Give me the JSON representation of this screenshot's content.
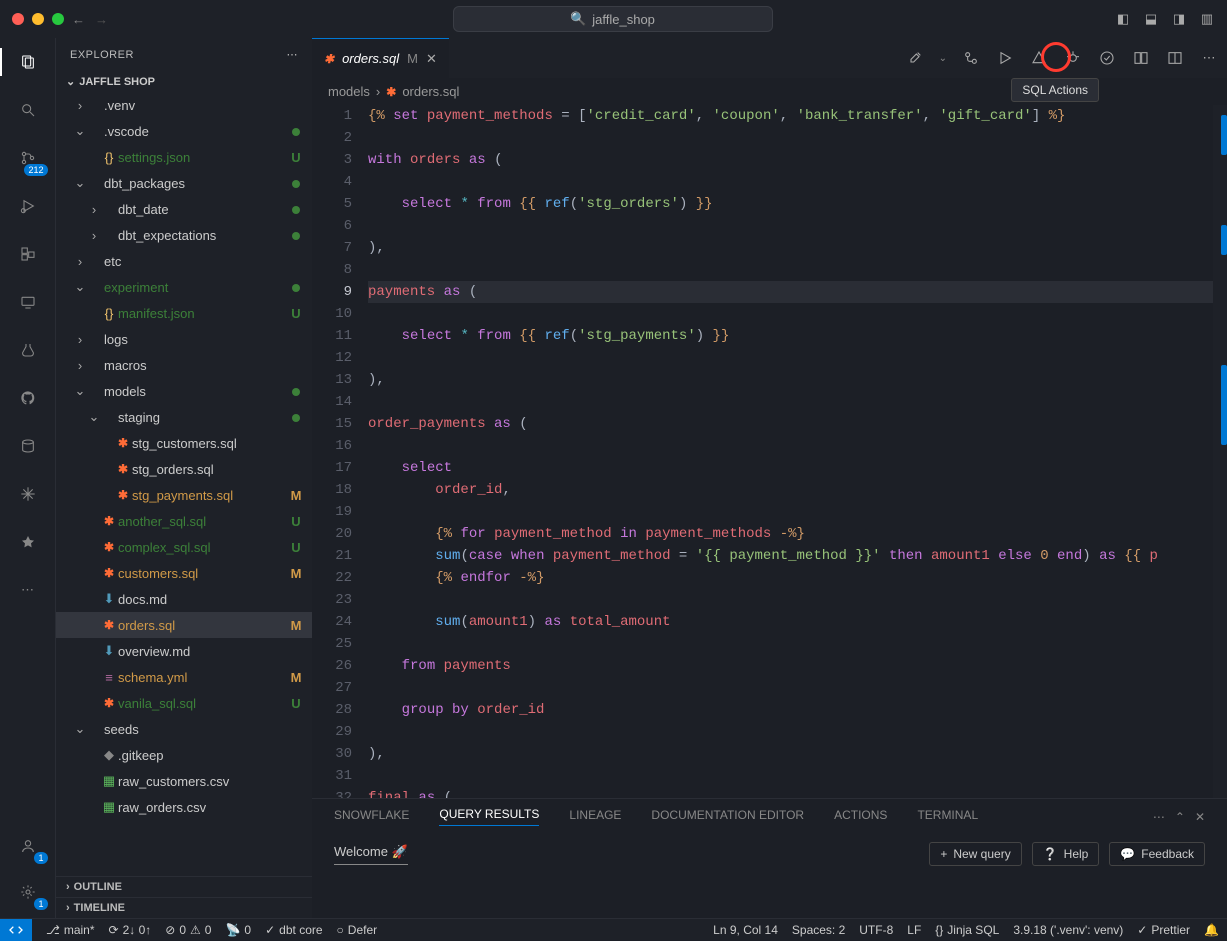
{
  "title_search": "jaffle_shop",
  "explorer": {
    "title": "EXPLORER",
    "root": "JAFFLE SHOP"
  },
  "tree": [
    {
      "indent": 1,
      "tw": "›",
      "icon": "",
      "label": ".venv",
      "status": "",
      "cls": ""
    },
    {
      "indent": 1,
      "tw": "⌄",
      "icon": "",
      "label": ".vscode",
      "status": "dot",
      "cls": ""
    },
    {
      "indent": 2,
      "tw": "",
      "icon": "{}",
      "iconcls": "json-ic",
      "label": "settings.json",
      "status": "U",
      "cls": "git-u"
    },
    {
      "indent": 1,
      "tw": "⌄",
      "icon": "",
      "label": "dbt_packages",
      "status": "dot",
      "cls": ""
    },
    {
      "indent": 2,
      "tw": "›",
      "icon": "",
      "label": "dbt_date",
      "status": "dot",
      "cls": ""
    },
    {
      "indent": 2,
      "tw": "›",
      "icon": "",
      "label": "dbt_expectations",
      "status": "dot",
      "cls": ""
    },
    {
      "indent": 1,
      "tw": "›",
      "icon": "",
      "label": "etc",
      "status": "",
      "cls": ""
    },
    {
      "indent": 1,
      "tw": "⌄",
      "icon": "",
      "label": "experiment",
      "status": "dot",
      "cls": "git-u"
    },
    {
      "indent": 2,
      "tw": "",
      "icon": "{}",
      "iconcls": "json-ic",
      "label": "manifest.json",
      "status": "U",
      "cls": "git-u"
    },
    {
      "indent": 1,
      "tw": "›",
      "icon": "",
      "label": "logs",
      "status": "",
      "cls": ""
    },
    {
      "indent": 1,
      "tw": "›",
      "icon": "",
      "label": "macros",
      "status": "",
      "cls": ""
    },
    {
      "indent": 1,
      "tw": "⌄",
      "icon": "",
      "label": "models",
      "status": "dot",
      "cls": ""
    },
    {
      "indent": 2,
      "tw": "⌄",
      "icon": "",
      "label": "staging",
      "status": "dot",
      "cls": ""
    },
    {
      "indent": 3,
      "tw": "",
      "icon": "✱",
      "iconcls": "dbt-ic",
      "label": "stg_customers.sql",
      "status": "",
      "cls": ""
    },
    {
      "indent": 3,
      "tw": "",
      "icon": "✱",
      "iconcls": "dbt-ic",
      "label": "stg_orders.sql",
      "status": "",
      "cls": ""
    },
    {
      "indent": 3,
      "tw": "",
      "icon": "✱",
      "iconcls": "dbt-ic",
      "label": "stg_payments.sql",
      "status": "M",
      "cls": "git-m"
    },
    {
      "indent": 2,
      "tw": "",
      "icon": "✱",
      "iconcls": "dbt-ic",
      "label": "another_sql.sql",
      "status": "U",
      "cls": "git-u"
    },
    {
      "indent": 2,
      "tw": "",
      "icon": "✱",
      "iconcls": "dbt-ic",
      "label": "complex_sql.sql",
      "status": "U",
      "cls": "git-u"
    },
    {
      "indent": 2,
      "tw": "",
      "icon": "✱",
      "iconcls": "dbt-ic",
      "label": "customers.sql",
      "status": "M",
      "cls": "git-m"
    },
    {
      "indent": 2,
      "tw": "",
      "icon": "⬇",
      "iconcls": "md-ic",
      "label": "docs.md",
      "status": "",
      "cls": ""
    },
    {
      "indent": 2,
      "tw": "",
      "icon": "✱",
      "iconcls": "dbt-ic",
      "label": "orders.sql",
      "status": "M",
      "cls": "git-m",
      "sel": true
    },
    {
      "indent": 2,
      "tw": "",
      "icon": "⬇",
      "iconcls": "md-ic",
      "label": "overview.md",
      "status": "",
      "cls": ""
    },
    {
      "indent": 2,
      "tw": "",
      "icon": "≡",
      "iconcls": "yml-ic",
      "label": "schema.yml",
      "status": "M",
      "cls": "git-m"
    },
    {
      "indent": 2,
      "tw": "",
      "icon": "✱",
      "iconcls": "dbt-ic",
      "label": "vanila_sql.sql",
      "status": "U",
      "cls": "git-u"
    },
    {
      "indent": 1,
      "tw": "⌄",
      "icon": "",
      "label": "seeds",
      "status": "",
      "cls": ""
    },
    {
      "indent": 2,
      "tw": "",
      "icon": "◆",
      "iconcls": "gen-ic",
      "label": ".gitkeep",
      "status": "",
      "cls": ""
    },
    {
      "indent": 2,
      "tw": "",
      "icon": "▦",
      "iconcls": "csv-ic",
      "label": "raw_customers.csv",
      "status": "",
      "cls": ""
    },
    {
      "indent": 2,
      "tw": "",
      "icon": "▦",
      "iconcls": "csv-ic",
      "label": "raw_orders.csv",
      "status": "",
      "cls": ""
    }
  ],
  "outline": "OUTLINE",
  "timeline": "TIMELINE",
  "tab": {
    "label": "orders.sql",
    "suffix": "M"
  },
  "tooltip": "SQL Actions",
  "breadcrumb": {
    "seg1": "models",
    "seg2": "orders.sql"
  },
  "activity_badge_git": "212",
  "code_lines": [
    "<span class='c-tpl'>{%</span> <span class='c-kw'>set</span> <span class='c-id'>payment_methods</span> <span class='c-pn'>=</span> <span class='c-pn'>[</span><span class='c-str'>'credit_card'</span><span class='c-pn'>,</span> <span class='c-str'>'coupon'</span><span class='c-pn'>,</span> <span class='c-str'>'bank_transfer'</span><span class='c-pn'>,</span> <span class='c-str'>'gift_card'</span><span class='c-pn'>]</span> <span class='c-tpl'>%}</span>",
    "",
    "<span class='c-kw'>with</span> <span class='c-id'>orders</span> <span class='c-kw'>as</span> <span class='c-pn'>(</span>",
    "",
    "    <span class='c-kw'>select</span> <span class='c-op'>*</span> <span class='c-kw'>from</span> <span class='c-tpl'>{{</span> <span class='c-fn'>ref</span><span class='c-pn'>(</span><span class='c-str'>'stg_orders'</span><span class='c-pn'>)</span> <span class='c-tpl'>}}</span>",
    "",
    "<span class='c-pn'>),</span>",
    "",
    "<span class='c-id'>payments</span> <span class='c-kw'>as</span> <span class='c-pn'>(</span>",
    "",
    "    <span class='c-kw'>select</span> <span class='c-op'>*</span> <span class='c-kw'>from</span> <span class='c-tpl'>{{</span> <span class='c-fn'>ref</span><span class='c-pn'>(</span><span class='c-str'>'stg_payments'</span><span class='c-pn'>)</span> <span class='c-tpl'>}}</span>",
    "",
    "<span class='c-pn'>),</span>",
    "",
    "<span class='c-id'>order_payments</span> <span class='c-kw'>as</span> <span class='c-pn'>(</span>",
    "",
    "    <span class='c-kw'>select</span>",
    "        <span class='c-id'>order_id</span><span class='c-pn'>,</span>",
    "",
    "        <span class='c-tpl'>{%</span> <span class='c-kw'>for</span> <span class='c-id'>payment_method</span> <span class='c-kw'>in</span> <span class='c-id'>payment_methods</span> <span class='c-tpl'>-%}</span>",
    "        <span class='c-fn'>sum</span><span class='c-pn'>(</span><span class='c-kw'>case</span> <span class='c-kw'>when</span> <span class='c-id'>payment_method</span> <span class='c-pn'>=</span> <span class='c-str'>'{{ payment_method }}'</span> <span class='c-kw'>then</span> <span class='c-id'>amount1</span> <span class='c-kw'>else</span> <span class='c-num'>0</span> <span class='c-kw'>end</span><span class='c-pn'>)</span> <span class='c-kw'>as</span> <span class='c-tpl'>{{</span> <span class='c-id'>p</span>",
    "        <span class='c-tpl'>{%</span> <span class='c-kw'>endfor</span> <span class='c-tpl'>-%}</span>",
    "",
    "        <span class='c-fn'>sum</span><span class='c-pn'>(</span><span class='c-id'>amount1</span><span class='c-pn'>)</span> <span class='c-kw'>as</span> <span class='c-id'>total_amount</span>",
    "",
    "    <span class='c-kw'>from</span> <span class='c-id'>payments</span>",
    "",
    "    <span class='c-kw'>group</span> <span class='c-kw'>by</span> <span class='c-id'>order_id</span>",
    "",
    "<span class='c-pn'>),</span>",
    "",
    "<span class='c-id'>final</span> <span class='c-kw'>as</span> <span class='c-pn'>(</span>"
  ],
  "current_line": 9,
  "panel": {
    "tabs": [
      "SNOWFLAKE",
      "QUERY RESULTS",
      "LINEAGE",
      "DOCUMENTATION EDITOR",
      "ACTIONS",
      "TERMINAL"
    ],
    "active": 1,
    "welcome": "Welcome 🚀",
    "btn_new": "New query",
    "btn_help": "Help",
    "btn_feedback": "Feedback"
  },
  "status": {
    "branch": "main*",
    "sync": "2↓ 0↑",
    "errors": "0",
    "warnings": "0",
    "ports": "0",
    "dbt": "dbt core",
    "defer": "Defer",
    "pos": "Ln 9, Col 14",
    "spaces": "Spaces: 2",
    "enc": "UTF-8",
    "eol": "LF",
    "lang": "Jinja SQL",
    "py": "3.9.18 ('.venv': venv)",
    "prettier": "Prettier"
  }
}
